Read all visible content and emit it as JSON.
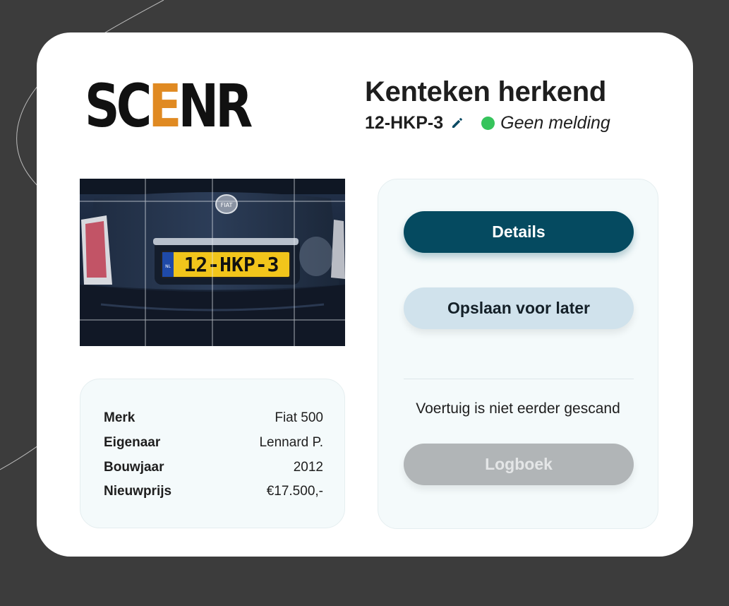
{
  "brand": {
    "logo_left": "SC",
    "logo_accent": "E",
    "logo_right": "NR"
  },
  "header": {
    "title": "Kenteken herkend",
    "plate": "12-HKP-3",
    "status": "Geen melding"
  },
  "photo": {
    "plate_text": "12-HKP-3",
    "plate_country": "NL"
  },
  "vehicle_info": [
    {
      "label": "Merk",
      "value": "Fiat 500"
    },
    {
      "label": "Eigenaar",
      "value": "Lennard P."
    },
    {
      "label": "Bouwjaar",
      "value": "2012"
    },
    {
      "label": "Nieuwprijs",
      "value": "€17.500,-"
    }
  ],
  "actions": {
    "details_label": "Details",
    "save_label": "Opslaan voor later",
    "scan_note": "Voertuig is niet eerder gescand",
    "logbook_label": "Logboek"
  },
  "colors": {
    "background": "#3c3c3c",
    "primary": "#054a60",
    "secondary": "#d0e2ec",
    "disabled": "#b1b5b7",
    "accent": "#e08a22",
    "status_ok": "#36c45c"
  },
  "icons": {
    "edit": "pencil-icon",
    "status": "status-dot-icon"
  }
}
